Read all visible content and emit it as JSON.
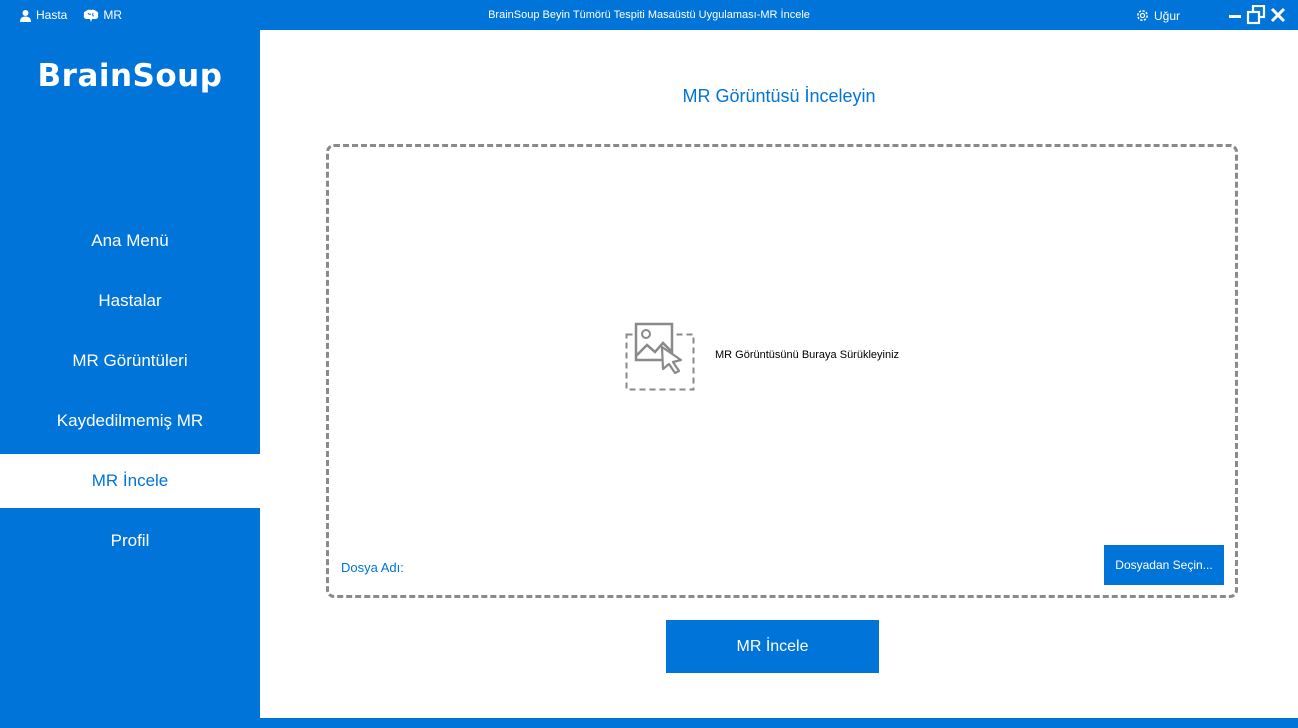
{
  "titlebar": {
    "patient_label": "Hasta",
    "mr_label": "MR",
    "window_title": "BrainSoup Beyin Tümörü Tespiti Masaüstü Uygulaması-MR İncele",
    "user_label": "Uğur"
  },
  "sidebar": {
    "logo": "BrainSoup",
    "items": [
      {
        "label": "Ana Menü"
      },
      {
        "label": "Hastalar"
      },
      {
        "label": "MR Görüntüleri"
      },
      {
        "label": "Kaydedilmemiş MR"
      },
      {
        "label": "MR İncele"
      },
      {
        "label": "Profil"
      }
    ]
  },
  "main": {
    "title": "MR Görüntüsü İnceleyin",
    "dropzone": {
      "hint": "MR Görüntüsünü Buraya Sürükleyiniz",
      "file_name_label": "Dosya Adı:",
      "choose_file_label": "Dosyadan Seçin..."
    },
    "analyze_button": "MR İncele"
  },
  "colors": {
    "accent": "#0074d9",
    "background": "#ffffff"
  }
}
